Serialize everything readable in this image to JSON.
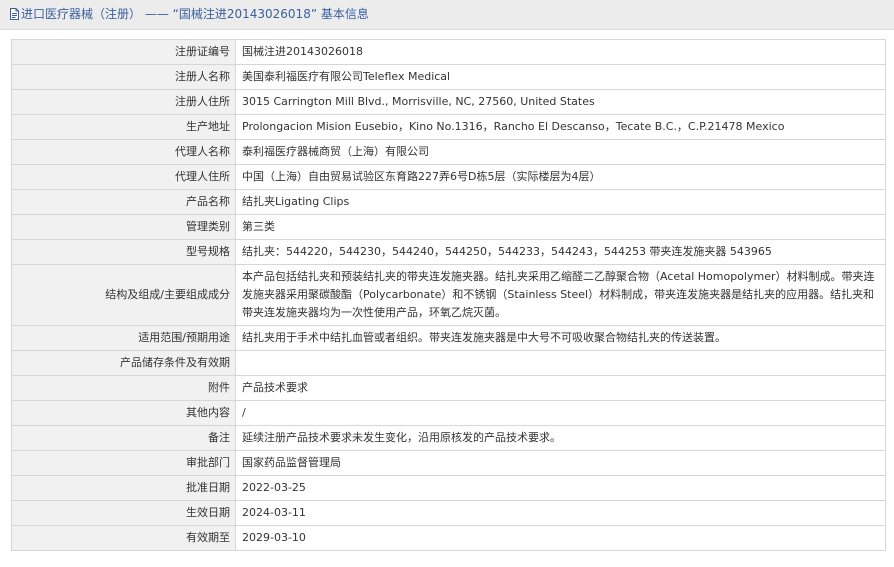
{
  "header": {
    "title": "进口医疗器械（注册） —— “国械注进20143026018” 基本信息"
  },
  "fields": [
    {
      "label": "注册证编号",
      "value": "国械注进20143026018"
    },
    {
      "label": "注册人名称",
      "value": "美国泰利福医疗有限公司Teleflex Medical"
    },
    {
      "label": "注册人住所",
      "value": "3015 Carrington Mill Blvd., Morrisville, NC, 27560, United States"
    },
    {
      "label": "生产地址",
      "value": "Prolongacion Mision Eusebio，Kino No.1316，Rancho El Descanso，Tecate B.C.，C.P.21478 Mexico"
    },
    {
      "label": "代理人名称",
      "value": "泰利福医疗器械商贸（上海）有限公司"
    },
    {
      "label": "代理人住所",
      "value": "中国（上海）自由贸易试验区东育路227弄6号D栋5层（实际楼层为4层）"
    },
    {
      "label": "产品名称",
      "value": "结扎夹Ligating Clips"
    },
    {
      "label": "管理类别",
      "value": "第三类"
    },
    {
      "label": "型号规格",
      "value": "结扎夹：544220，544230，544240，544250，544233，544243，544253 带夹连发施夹器 543965"
    },
    {
      "label": "结构及组成/主要组成成分",
      "value": "本产品包括结扎夹和预装结扎夹的带夹连发施夹器。结扎夹采用乙缩醛二乙醇聚合物（Acetal Homopolymer）材料制成。带夹连发施夹器采用聚碳酸酯（Polycarbonate）和不锈钢（Stainless Steel）材料制成，带夹连发施夹器是结扎夹的应用器。结扎夹和带夹连发施夹器均为一次性使用产品，环氧乙烷灭菌。"
    },
    {
      "label": "适用范围/预期用途",
      "value": "结扎夹用于手术中结扎血管或者组织。带夹连发施夹器是中大号不可吸收聚合物结扎夹的传送装置。"
    },
    {
      "label": "产品储存条件及有效期",
      "value": ""
    },
    {
      "label": "附件",
      "value": "产品技术要求"
    },
    {
      "label": "其他内容",
      "value": "/"
    },
    {
      "label": "备注",
      "value": "延续注册产品技术要求未发生变化，沿用原核发的产品技术要求。"
    },
    {
      "label": "审批部门",
      "value": "国家药品监督管理局"
    },
    {
      "label": "批准日期",
      "value": "2022-03-25"
    },
    {
      "label": "生效日期",
      "value": "2024-03-11"
    },
    {
      "label": "有效期至",
      "value": "2029-03-10"
    }
  ]
}
